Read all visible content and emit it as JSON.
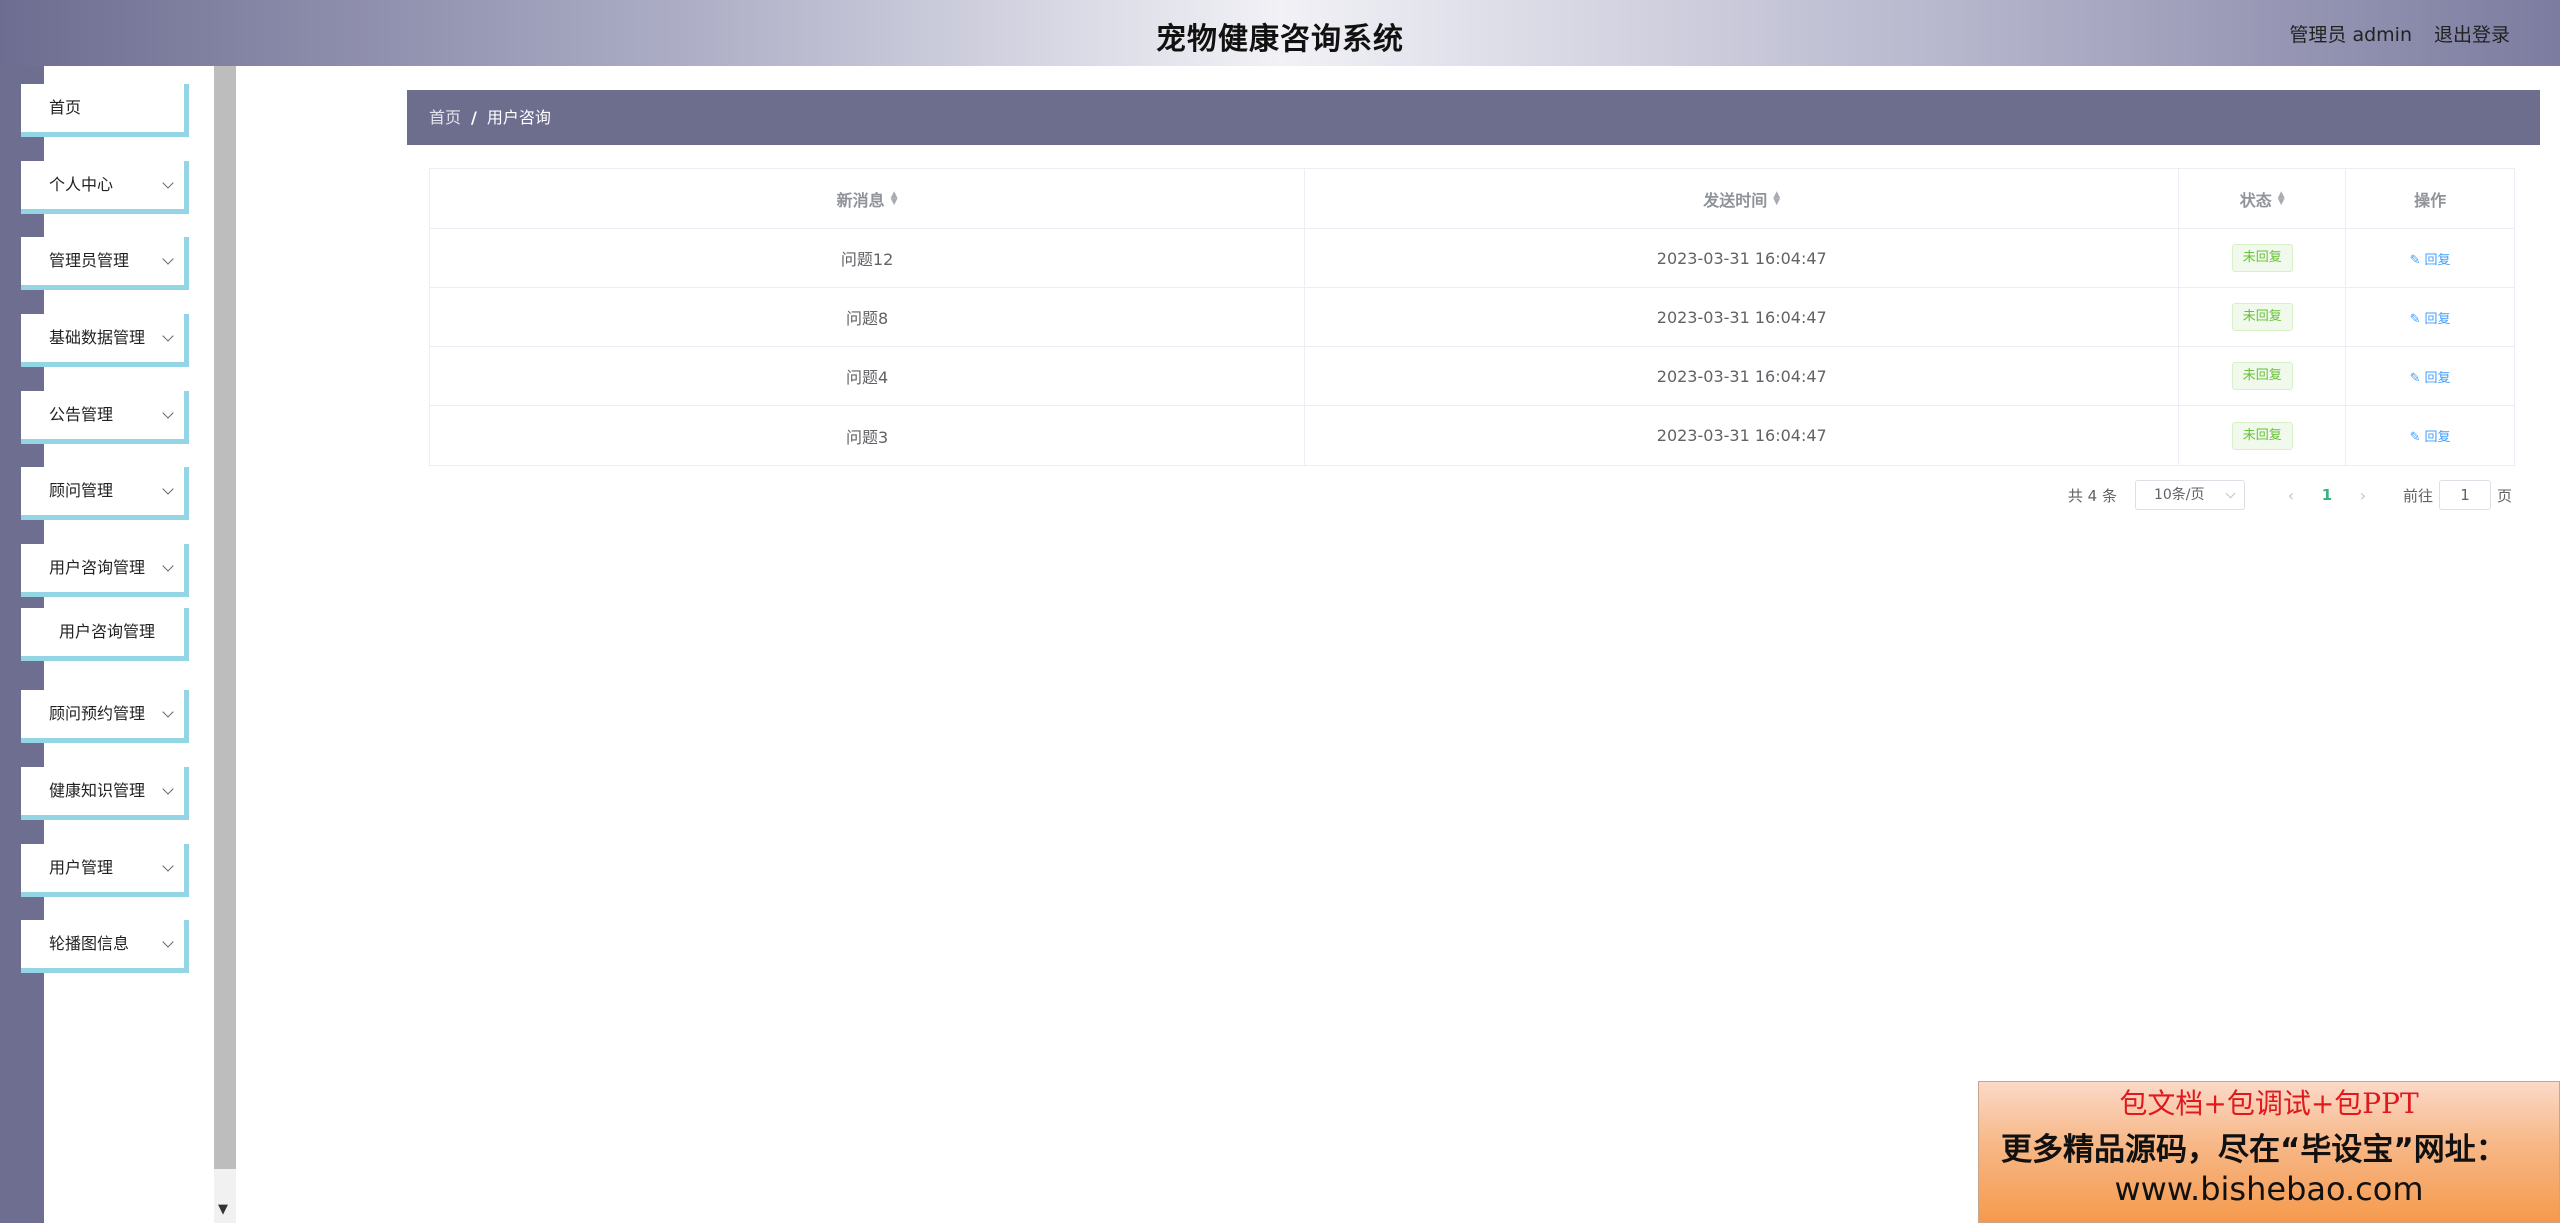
{
  "header": {
    "title": "宠物健康咨询系统",
    "user": "管理员 admin",
    "logout": "退出登录"
  },
  "sidebar": {
    "items": [
      {
        "label": "首页"
      },
      {
        "label": "个人中心"
      },
      {
        "label": "管理员管理"
      },
      {
        "label": "基础数据管理"
      },
      {
        "label": "公告管理"
      },
      {
        "label": "顾问管理"
      },
      {
        "label": "用户咨询管理"
      },
      {
        "label": "用户咨询管理"
      },
      {
        "label": "顾问预约管理"
      },
      {
        "label": "健康知识管理"
      },
      {
        "label": "用户管理"
      },
      {
        "label": "轮播图信息"
      }
    ]
  },
  "breadcrumb": {
    "home": "首页",
    "separator": "/",
    "current": "用户咨询"
  },
  "table": {
    "columns": [
      "新消息",
      "发送时间",
      "状态",
      "操作"
    ],
    "rows": [
      {
        "message": "问题12",
        "time": "2023-03-31 16:04:47",
        "status": "未回复",
        "action": "回复"
      },
      {
        "message": "问题8",
        "time": "2023-03-31 16:04:47",
        "status": "未回复",
        "action": "回复"
      },
      {
        "message": "问题4",
        "time": "2023-03-31 16:04:47",
        "status": "未回复",
        "action": "回复"
      },
      {
        "message": "问题3",
        "time": "2023-03-31 16:04:47",
        "status": "未回复",
        "action": "回复"
      }
    ]
  },
  "pagination": {
    "total": "共 4 条",
    "page_size": "10条/页",
    "current_page": "1",
    "goto": "前往",
    "goto_value": "1",
    "page_suffix": "页"
  },
  "ad": {
    "line1": "包文档+包调试+包PPT",
    "line2": "更多精品源码，尽在“毕设宝”网址：",
    "line3": "www.bishebao.com"
  },
  "colors": {
    "accent": "#6d6d8e",
    "menu_border": "#93d5e4",
    "status_green": "#67c23a",
    "link_blue": "#409eff"
  }
}
